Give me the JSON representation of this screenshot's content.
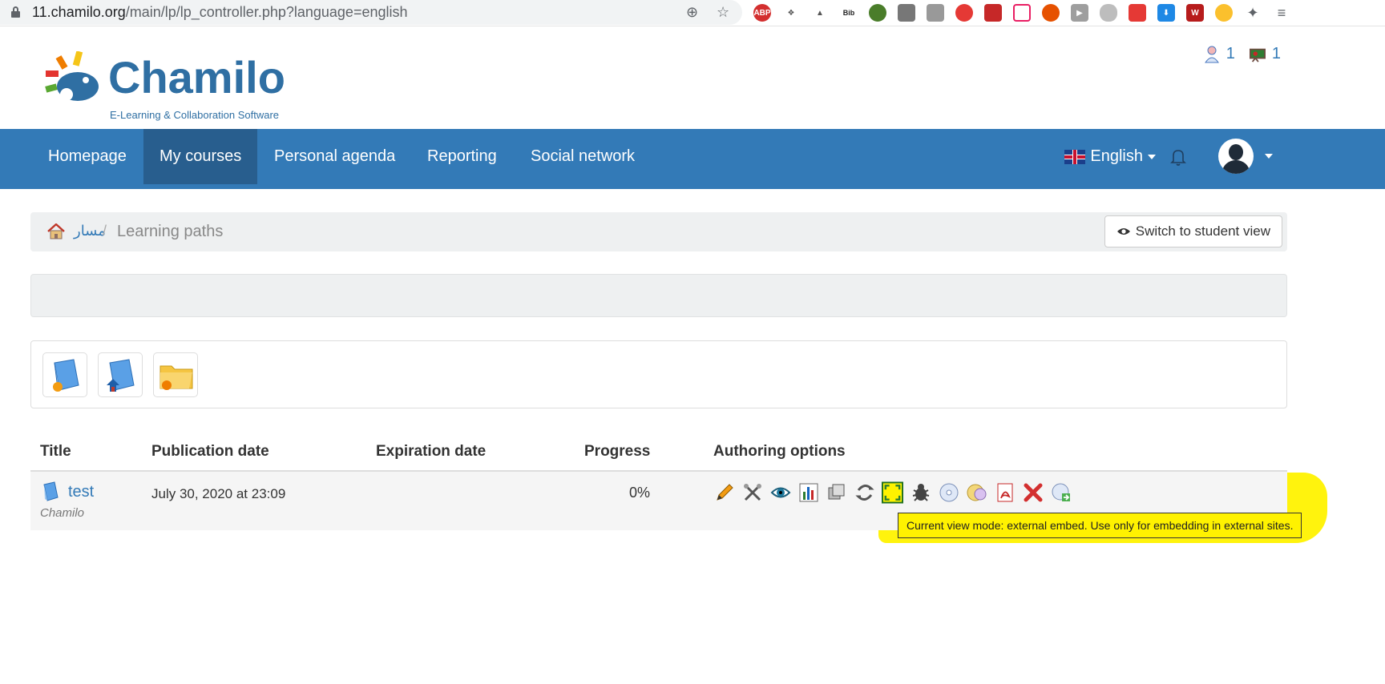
{
  "browser": {
    "url_host": "11.chamilo.org",
    "url_path": "/main/lp/lp_controller.php?language=english"
  },
  "header": {
    "logo_word": "Chamilo",
    "logo_tagline": "E-Learning & Collaboration Software",
    "users_online": "1",
    "teachers_online": "1"
  },
  "nav": {
    "items": [
      "Homepage",
      "My courses",
      "Personal agenda",
      "Reporting",
      "Social network"
    ],
    "active": "My courses",
    "language": "English"
  },
  "breadcrumb": {
    "course_link": "مسار",
    "separator": "/",
    "current": "Learning paths",
    "switch_label": "Switch to student view"
  },
  "table": {
    "headers": [
      "Title",
      "Publication date",
      "Expiration date",
      "Progress",
      "Authoring options"
    ],
    "rows": [
      {
        "title": "test",
        "author": "Chamilo",
        "publication_date": "July 30, 2020 at 23:09",
        "expiration_date": "",
        "progress": "0%"
      }
    ]
  },
  "tooltip": "Current view mode: external embed. Use only for embedding in external sites.",
  "colors": {
    "brand": "#337ab7",
    "nav_active": "#285e8e",
    "highlight": "#fff200"
  }
}
